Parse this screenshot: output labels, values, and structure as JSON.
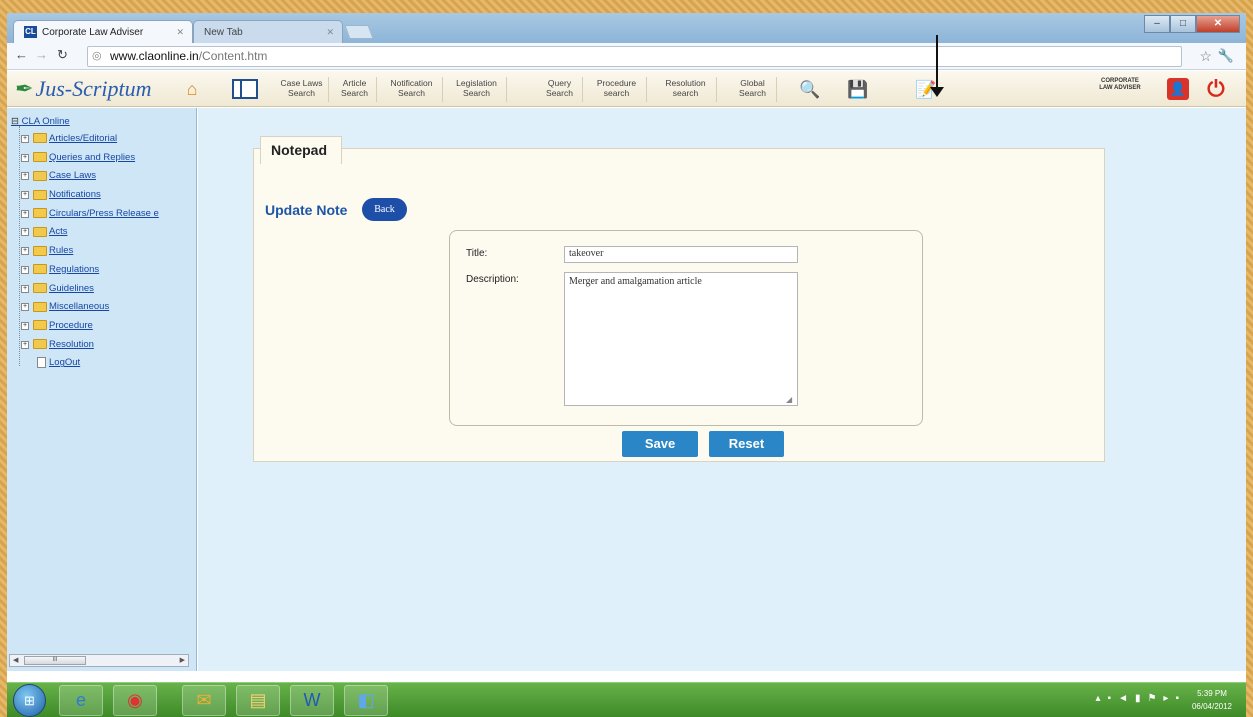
{
  "browser": {
    "tabs": [
      {
        "label": "Corporate Law Adviser",
        "favicon": "CL"
      },
      {
        "label": "New Tab"
      }
    ],
    "url_host": "www.claonline.in",
    "url_path": "/Content.htm"
  },
  "toolbar": {
    "logo": "Jus-Scriptum",
    "buttons": [
      {
        "label": "Case Laws\nSearch"
      },
      {
        "label": "Article\nSearch"
      },
      {
        "label": "Notification\nSearch"
      },
      {
        "label": "Legislation\nSearch"
      },
      {
        "label": "Query\nSearch"
      },
      {
        "label": "Procedure\nsearch"
      },
      {
        "label": "Resolution\nsearch"
      },
      {
        "label": "Global\nSearch"
      }
    ],
    "badge": "CORPORATE LAW ADVISER"
  },
  "sidebar": {
    "root": "CLA Online",
    "items": [
      "Articles/Editorial",
      "Queries and Replies",
      "Case Laws",
      "Notifications",
      "Circulars/Press Release e",
      "Acts",
      "Rules",
      "Regulations",
      "Guidelines",
      "Miscellaneous",
      "Procedure",
      "Resolution"
    ],
    "logout": "LogOut"
  },
  "notepad": {
    "tab_label": "Notepad",
    "heading": "Update Note",
    "back_label": "Back",
    "title_label": "Title:",
    "title_value": "takeover",
    "description_label": "Description:",
    "description_value": "Merger and amalgamation article",
    "save_label": "Save",
    "reset_label": "Reset"
  },
  "taskbar": {
    "time": "5:39 PM",
    "date": "06/04/2012"
  }
}
